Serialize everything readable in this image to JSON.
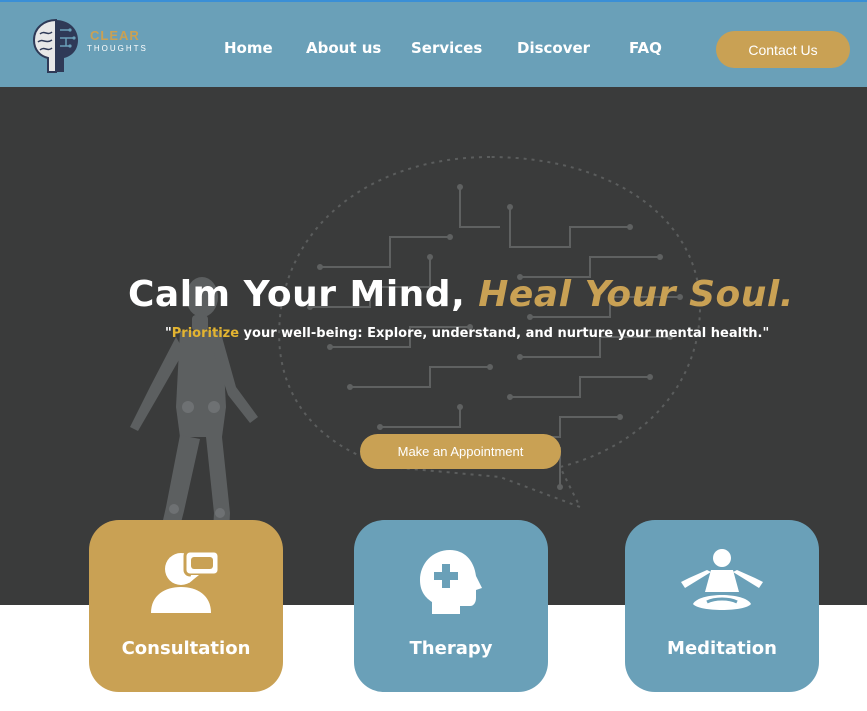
{
  "brand": {
    "name_line1": "CLEAR",
    "name_line2": "THOUGHTS"
  },
  "nav": {
    "links": [
      "Home",
      "About us",
      "Services",
      "Discover",
      "FAQ"
    ],
    "contact_label": "Contact Us"
  },
  "hero": {
    "title_main": "Calm Your Mind, ",
    "title_accent": "Heal Your Soul.",
    "subtitle_quote_open": "\"",
    "subtitle_highlight": "Prioritize",
    "subtitle_rest": " your well-being: Explore, understand, and nurture your mental health.\"",
    "cta_label": "Make an Appointment"
  },
  "cards": [
    {
      "label": "Consultation",
      "icon": "consultation-icon"
    },
    {
      "label": "Therapy",
      "icon": "therapy-icon"
    },
    {
      "label": "Meditation",
      "icon": "meditation-icon"
    }
  ],
  "colors": {
    "nav_bg": "#6aa0b8",
    "hero_bg": "#3a3b3b",
    "accent_gold": "#c9a154",
    "highlight_yellow": "#e3b431",
    "card_blue": "#6aa0b8"
  }
}
